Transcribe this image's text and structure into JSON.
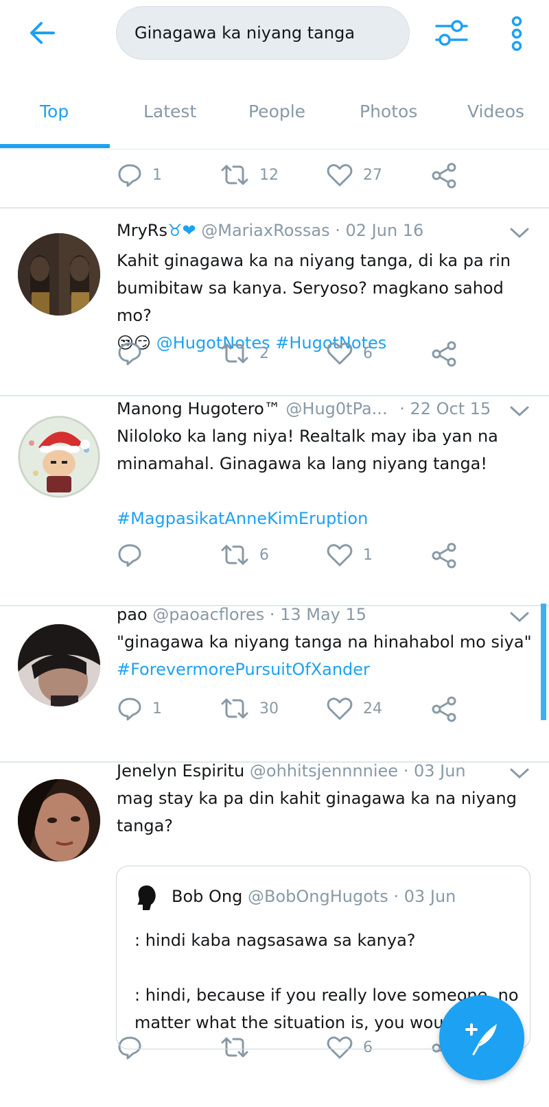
{
  "search": {
    "query": "Ginagawa ka niyang tanga"
  },
  "tabs": [
    "Top",
    "Latest",
    "People",
    "Photos",
    "Videos"
  ],
  "icons": {
    "back": "arrow-left-icon",
    "filter": "sliders-icon",
    "more": "vertical-dots-icon",
    "reply": "reply-icon",
    "retweet": "retweet-icon",
    "like": "heart-icon",
    "share": "share-icon",
    "compose": "feather-plus-icon"
  },
  "colors": {
    "accent": "#1da1f2",
    "muted": "#8899a6",
    "text": "#14171a",
    "divider": "#e1e8ed"
  },
  "top_actions": {
    "replies": "1",
    "retweets": "12",
    "likes": "27"
  },
  "tweets": [
    {
      "name": "MryRs",
      "emoji": "♉❤",
      "handle": "@MariaxRossas",
      "date": "· 02 Jun 16",
      "line1": "Kahit ginagawa ka na niyang tanga, di ka pa rin",
      "line2": "bumibitaw sa kanya. Seryoso? magkano sahod mo?",
      "emojis": "😒😏",
      "mention": "@HugotNotes",
      "hashtag": "#HugotNotes",
      "replies": "",
      "retweets": "2",
      "likes": "6"
    },
    {
      "name": "Manong Hugotero™",
      "handle": "@Hug0tPa...",
      "date": "· 22 Oct 15",
      "line1": "Niloloko ka lang niya! Realtalk may iba yan na",
      "line2": "minamahal. Ginagawa ka lang niyang tanga!",
      "hashtag": "#MagpasikatAnneKimEruption",
      "replies": "",
      "retweets": "6",
      "likes": "1"
    },
    {
      "name": "pao",
      "handle": "@paoacflores",
      "date": "· 13 May 15",
      "line1": "\"ginagawa ka niyang tanga na hinahabol mo siya\"",
      "hashtag": "#ForevermorePursuitOfXander",
      "replies": "1",
      "retweets": "30",
      "likes": "24"
    },
    {
      "name": "Jenelyn Espiritu",
      "handle": "@ohhitsjennnniee",
      "date": "· 03 Jun",
      "line1": "mag stay ka pa din kahit ginagawa ka na niyang",
      "line2": "tanga?",
      "replies": "",
      "retweets": "",
      "likes": "6",
      "quote": {
        "name": "Bob Ong",
        "handle": "@BobOngHugots",
        "date": "· 03 Jun",
        "line1": ": hindi kaba nagsasawa sa kanya?",
        "line2": ": hindi, because if you really love someone, no",
        "line3": "matter what the situation is, you would st"
      }
    }
  ]
}
